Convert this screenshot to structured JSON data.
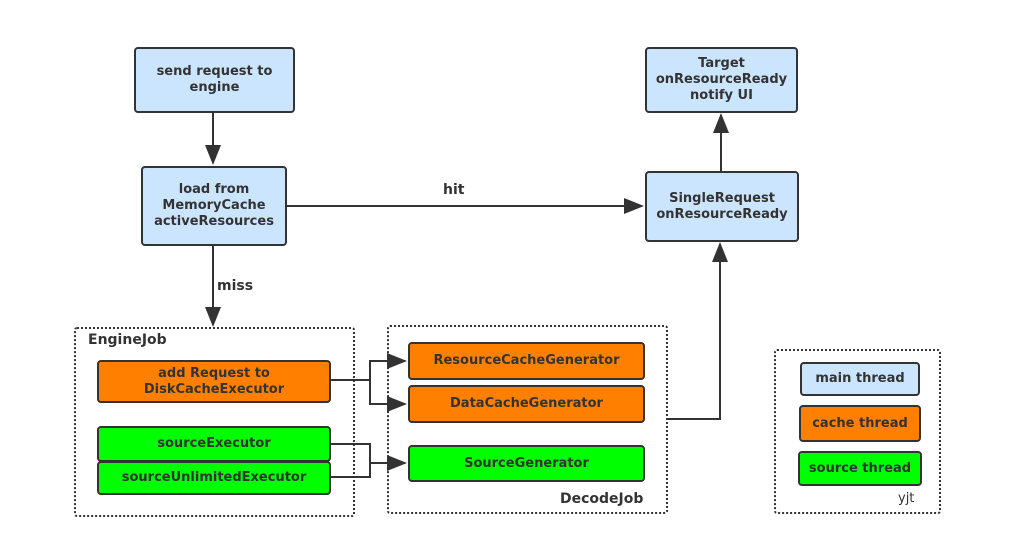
{
  "nodes": {
    "send_request": "send request to engine",
    "load_memory": "load from MemoryCache activeResources",
    "target": "Target onResourceReady notify UI",
    "single_request": "SingleRequest onResourceReady",
    "add_request": "add Request to DiskCacheExecutor",
    "source_executor": "sourceExecutor",
    "source_unlimited_executor": "sourceUnlimitedExecutor",
    "resource_cache_generator": "ResourceCacheGenerator",
    "data_cache_generator": "DataCacheGenerator",
    "source_generator": "SourceGenerator"
  },
  "groups": {
    "engine_job": "EngineJob",
    "decode_job": "DecodeJob"
  },
  "edges": {
    "hit": "hit",
    "miss": "miss"
  },
  "legend": {
    "main": "main thread",
    "cache": "cache thread",
    "source": "source thread",
    "author": "yjt"
  },
  "colors": {
    "main_thread": "#cce5ff",
    "cache_thread": "#ff8000",
    "source_thread": "#00ff00"
  }
}
